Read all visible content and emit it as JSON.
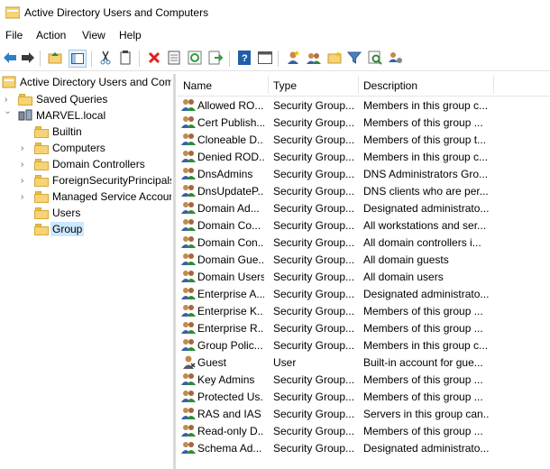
{
  "window": {
    "title": "Active Directory Users and Computers"
  },
  "menu": [
    "File",
    "Action",
    "View",
    "Help"
  ],
  "toolbar": [
    "back-icon",
    "forward-icon",
    "up-folder-icon",
    "show-tree-icon",
    "cut-icon",
    "copy-icon",
    "delete-icon",
    "properties-icon",
    "refresh-icon",
    "export-icon",
    "help-icon",
    "console-icon",
    "new-user-icon",
    "new-group-icon",
    "new-ou-icon",
    "filter-icon",
    "find-icon",
    "delegate-icon"
  ],
  "tree": {
    "root": "Active Directory Users and Com",
    "items": [
      {
        "label": "Saved Queries",
        "level": 1
      },
      {
        "label": "MARVEL.local",
        "level": 1,
        "expanded": true
      },
      {
        "label": "Builtin",
        "level": 2
      },
      {
        "label": "Computers",
        "level": 2
      },
      {
        "label": "Domain Controllers",
        "level": 2
      },
      {
        "label": "ForeignSecurityPrincipals",
        "level": 2
      },
      {
        "label": "Managed Service Accour",
        "level": 2
      },
      {
        "label": "Users",
        "level": 2
      },
      {
        "label": "Group",
        "level": 2,
        "selected": true
      }
    ]
  },
  "list": {
    "columns": [
      "Name",
      "Type",
      "Description"
    ],
    "rows": [
      {
        "name": "Allowed RO...",
        "type": "Security Group...",
        "desc": "Members in this group c...",
        "icon": "group"
      },
      {
        "name": "Cert Publish...",
        "type": "Security Group...",
        "desc": "Members of this group ...",
        "icon": "group"
      },
      {
        "name": "Cloneable D...",
        "type": "Security Group...",
        "desc": "Members of this group t...",
        "icon": "group"
      },
      {
        "name": "Denied ROD...",
        "type": "Security Group...",
        "desc": "Members in this group c...",
        "icon": "group"
      },
      {
        "name": "DnsAdmins",
        "type": "Security Group...",
        "desc": "DNS Administrators Gro...",
        "icon": "group"
      },
      {
        "name": "DnsUpdateP...",
        "type": "Security Group...",
        "desc": "DNS clients who are per...",
        "icon": "group"
      },
      {
        "name": "Domain Ad...",
        "type": "Security Group...",
        "desc": "Designated administrato...",
        "icon": "group"
      },
      {
        "name": "Domain Co...",
        "type": "Security Group...",
        "desc": "All workstations and ser...",
        "icon": "group"
      },
      {
        "name": "Domain Con...",
        "type": "Security Group...",
        "desc": "All domain controllers i...",
        "icon": "group"
      },
      {
        "name": "Domain Gue...",
        "type": "Security Group...",
        "desc": "All domain guests",
        "icon": "group"
      },
      {
        "name": "Domain Users",
        "type": "Security Group...",
        "desc": "All domain users",
        "icon": "group"
      },
      {
        "name": "Enterprise A...",
        "type": "Security Group...",
        "desc": "Designated administrato...",
        "icon": "group"
      },
      {
        "name": "Enterprise K...",
        "type": "Security Group...",
        "desc": "Members of this group ...",
        "icon": "group"
      },
      {
        "name": "Enterprise R...",
        "type": "Security Group...",
        "desc": "Members of this group ...",
        "icon": "group"
      },
      {
        "name": "Group Polic...",
        "type": "Security Group...",
        "desc": "Members in this group c...",
        "icon": "group"
      },
      {
        "name": "Guest",
        "type": "User",
        "desc": "Built-in account for gue...",
        "icon": "user"
      },
      {
        "name": "Key Admins",
        "type": "Security Group...",
        "desc": "Members of this group ...",
        "icon": "group"
      },
      {
        "name": "Protected Us...",
        "type": "Security Group...",
        "desc": "Members of this group ...",
        "icon": "group"
      },
      {
        "name": "RAS and IAS ...",
        "type": "Security Group...",
        "desc": "Servers in this group can...",
        "icon": "group"
      },
      {
        "name": "Read-only D...",
        "type": "Security Group...",
        "desc": "Members of this group ...",
        "icon": "group"
      },
      {
        "name": "Schema Ad...",
        "type": "Security Group...",
        "desc": "Designated administrato...",
        "icon": "group"
      }
    ]
  },
  "colors": {
    "selection": "#cce8ff",
    "folder": "#f5d376"
  }
}
